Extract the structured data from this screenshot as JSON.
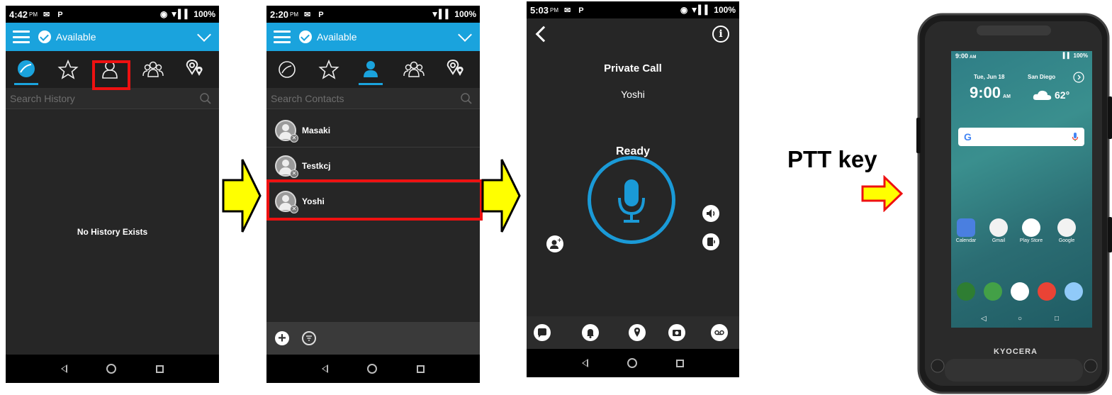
{
  "screens": {
    "history": {
      "status_time": "4:42",
      "status_ampm": "PM",
      "status_icons": "✉ P",
      "status_right": "◉ ▼▍▍ 100%",
      "presence": "Available",
      "search_placeholder": "Search History",
      "empty_message": "No History Exists"
    },
    "contacts": {
      "status_time": "2:20",
      "status_ampm": "PM",
      "status_icons": "✉ P",
      "status_right": "▼▍▍ 100%",
      "presence": "Available",
      "search_placeholder": "Search Contacts",
      "items": [
        {
          "name": "Masaki"
        },
        {
          "name": "Testkcj"
        },
        {
          "name": "Yoshi"
        }
      ]
    },
    "call": {
      "status_time": "5:03",
      "status_ampm": "PM",
      "status_icons": "✉ P",
      "status_right": "◉ ▼▍▍ 100%",
      "title": "Private Call",
      "contact": "Yoshi",
      "state": "Ready",
      "info_glyph": "i"
    }
  },
  "annotation": {
    "ptt_label": "PTT key"
  },
  "device": {
    "status_time": "9:00",
    "status_ampm": "AM",
    "status_right": "▍▍ 100%",
    "date": "Tue, Jun 18",
    "city": "San Diego",
    "clock": "9:00",
    "clock_ampm": "AM",
    "temperature": "62°",
    "google_letter": "G",
    "apps": [
      {
        "label": "Calendar",
        "color": "#4a7fe0"
      },
      {
        "label": "Gmail",
        "color": "#f2f2f2"
      },
      {
        "label": "Play Store",
        "color": "#ffffff"
      },
      {
        "label": "Google",
        "color": "#f2f2f2"
      }
    ],
    "dock_colors": [
      "#2e7d32",
      "#43a047",
      "#ffffff",
      "#ea4335",
      "#90caf9"
    ],
    "brand": "KYOCERA"
  },
  "colors": {
    "accent": "#1aa3dd",
    "highlight": "#ee1111",
    "arrow_fill": "#ffff00"
  }
}
